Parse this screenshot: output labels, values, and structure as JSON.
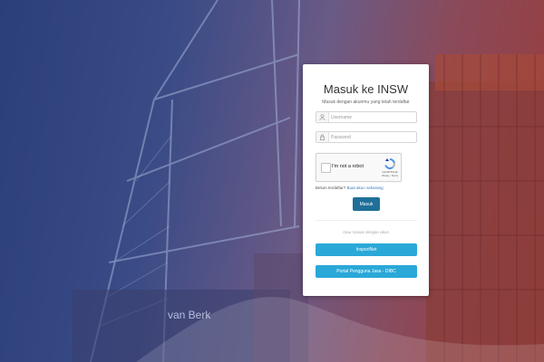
{
  "login": {
    "title": "Masuk ke INSW",
    "subtitle": "Masuk dengan akunmu yang telah terdaftar",
    "username_placeholder": "Username",
    "password_placeholder": "Password",
    "captcha": {
      "label": "I'm not a robot",
      "brand": "reCAPTCHA",
      "links": "Privacy - Terms"
    },
    "register_text": "Belum terdaftar?",
    "register_link": "Buat akun sekarang",
    "submit_label": "Masuk",
    "alt_text": "Atau masuk dengan akun",
    "alt_buttons": [
      "InsportNet",
      "Portal Pengguna Jasa - DIBC"
    ]
  },
  "background": {
    "ship_label": "van Berk"
  },
  "colors": {
    "primary_button": "#1f6f99",
    "alt_button": "#2aa8d8",
    "link": "#3a7bbf"
  },
  "icons": [
    "user-icon",
    "lock-icon",
    "recaptcha-logo-icon"
  ]
}
